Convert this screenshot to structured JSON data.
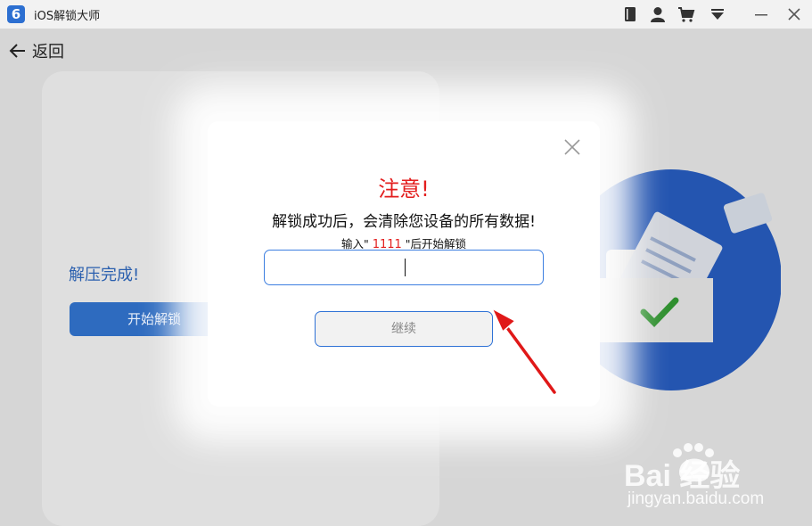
{
  "app": {
    "title": "iOS解锁大师",
    "logo_text": "6"
  },
  "titlebar_icons": [
    "book-icon",
    "user-icon",
    "cart-icon",
    "dropdown-icon",
    "minimize-icon",
    "close-icon"
  ],
  "nav": {
    "back_label": "返回"
  },
  "left_panel": {
    "status": "解压完成!",
    "start_button": "开始解锁"
  },
  "dialog": {
    "title": "注意!",
    "message": "解锁成功后，会清除您设备的所有数据!",
    "prompt_before": "输入\" ",
    "code": "1111",
    "prompt_after": " \"后开始解锁",
    "input_value": "",
    "continue_button": "继续"
  },
  "watermark": {
    "brand": "Bai 经验",
    "url": "jingyan.baidu.com"
  },
  "colors": {
    "accent_blue": "#2e6bbf",
    "alert_red": "#e31e1e",
    "input_border": "#3d7fe0"
  }
}
